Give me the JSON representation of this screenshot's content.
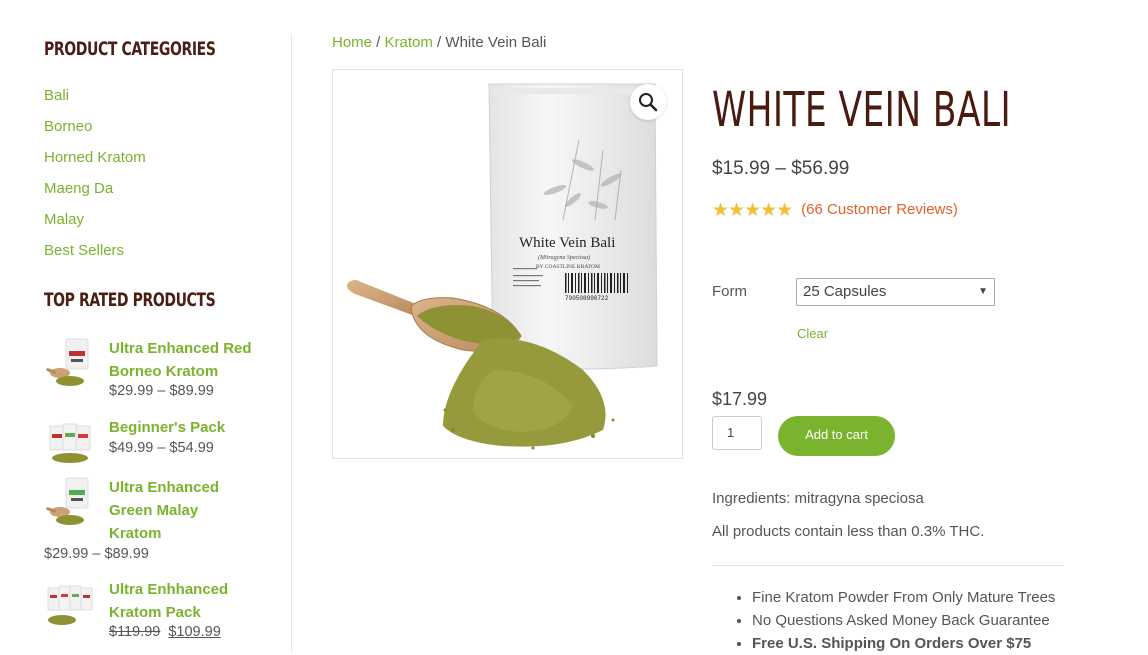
{
  "sidebar": {
    "categories_heading": "PRODUCT CATEGORIES",
    "categories": [
      "Bali",
      "Borneo",
      "Horned Kratom",
      "Maeng Da",
      "Malay",
      "Best Sellers"
    ],
    "top_rated_heading": "TOP RATED PRODUCTS",
    "top_rated": [
      {
        "name": "Ultra Enhanced Red Borneo Kratom",
        "price": "$29.99 – $89.99"
      },
      {
        "name": "Beginner's Pack",
        "price": "$49.99 – $54.99"
      },
      {
        "name": "Ultra Enhanced Green Malay Kratom",
        "price": "$29.99 – $89.99"
      },
      {
        "name": "Ultra Enhhanced Kratom Pack",
        "old_price": "$119.99",
        "sale_price": "$109.99"
      }
    ]
  },
  "breadcrumb": {
    "home": "Home",
    "sep": " / ",
    "category": "Kratom",
    "current": "White Vein Bali"
  },
  "product": {
    "title": "WHITE VEIN BALI",
    "price_range": "$15.99 – $56.99",
    "stars": "★★★★★",
    "rating_fraction": 1.0,
    "reviews": "(66 Customer Reviews)",
    "form_label": "Form",
    "form_value": "25 Capsules",
    "clear": "Clear",
    "variation_price": "$17.99",
    "quantity": "1",
    "add_to_cart": "Add to cart",
    "ingredients": "Ingredients: mitragyna speciosa",
    "thc_note": "All products contain less than 0.3% THC.",
    "features": [
      "Fine Kratom Powder From Only Mature Trees",
      "No Questions Asked Money Back Guarantee",
      "Free U.S. Shipping On Orders Over $75"
    ],
    "bag": {
      "title": "White Vein Bali",
      "subtitle": "(Mitragyna Speciosa)",
      "brand": "BY COASTLINE KRATOM",
      "barcode": "790508990722"
    }
  },
  "colors": {
    "accent": "#7ab32e",
    "title": "#4a1a10",
    "star": "#f2c037",
    "review_link": "#e2622a"
  }
}
